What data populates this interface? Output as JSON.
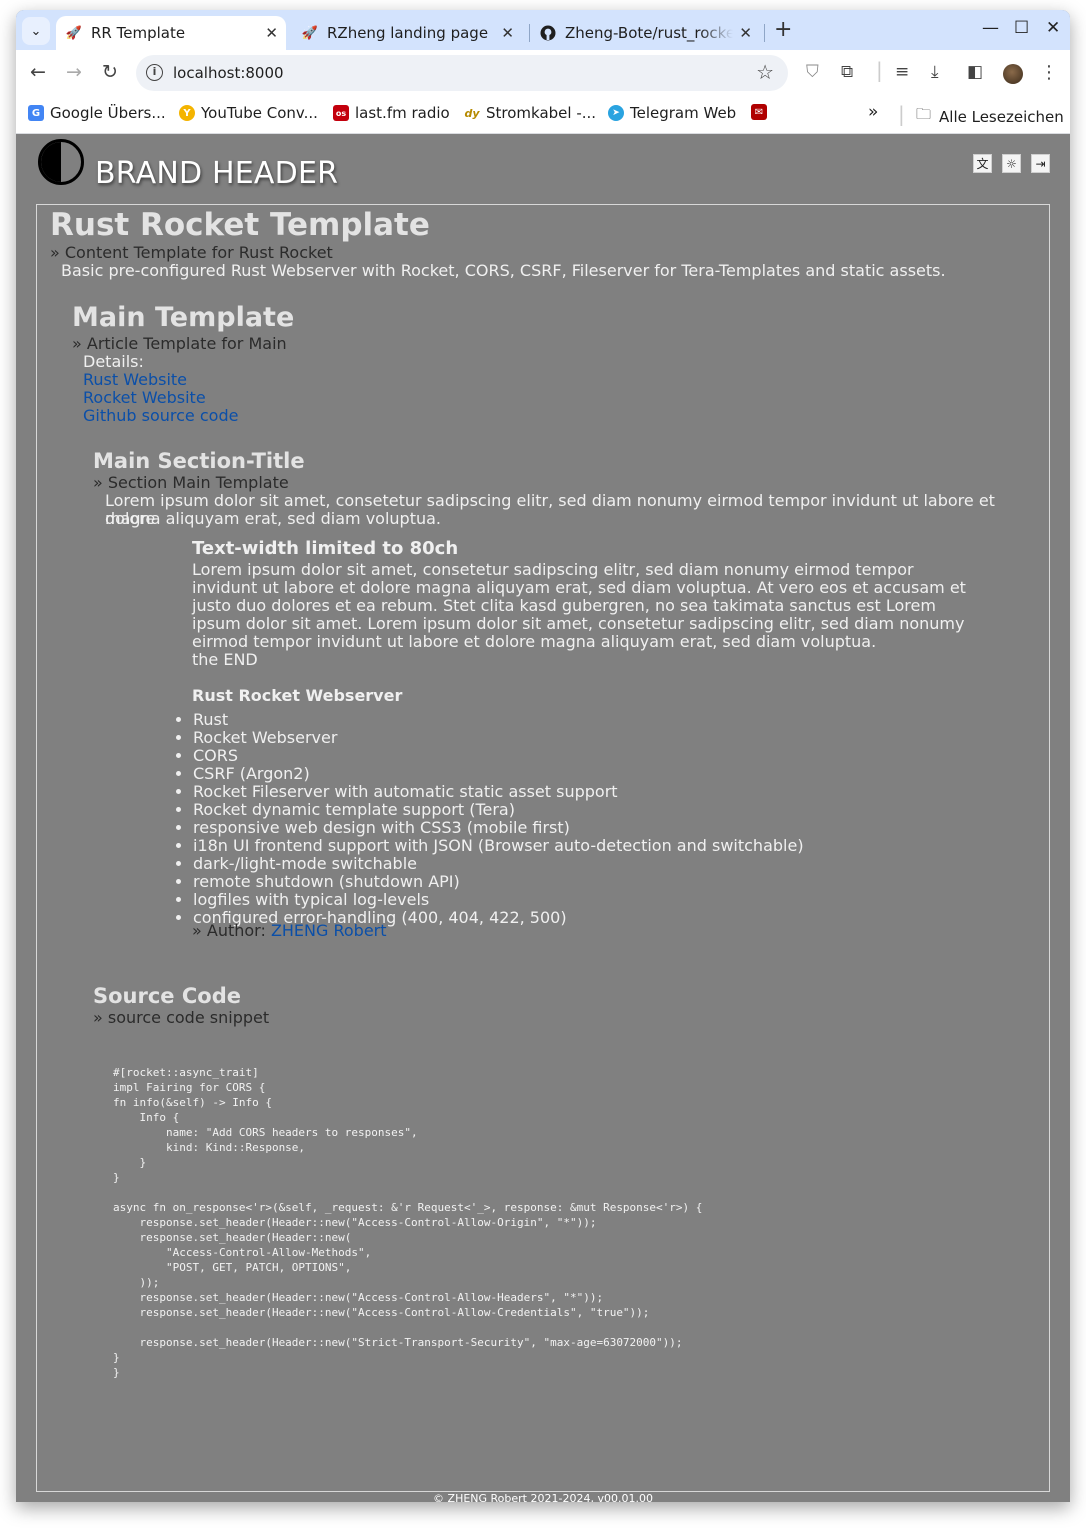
{
  "browser": {
    "tabs": [
      {
        "title": "RR Template",
        "close": "✕"
      },
      {
        "title": "RZheng landing page",
        "close": "✕"
      },
      {
        "title": "Zheng-Bote/rust_rocket",
        "close": "✕"
      }
    ],
    "new_tab": "+",
    "url": "localhost:8000",
    "window_controls": {
      "minimize": "—",
      "maximize": "☐",
      "close": "✕"
    },
    "bookmarks": [
      {
        "label": "Google Übers...",
        "icon": "G"
      },
      {
        "label": "YouTube Conv...",
        "icon": "Y"
      },
      {
        "label": "last.fm radio",
        "icon": "os"
      },
      {
        "label": "Stromkabel -...",
        "icon": "dy"
      },
      {
        "label": "Telegram Web",
        "icon": "➤"
      },
      {
        "label": "",
        "icon": "✉"
      }
    ],
    "bookmarks_overflow": "»",
    "all_bookmarks": "Alle Lesezeichen"
  },
  "header": {
    "brand": "BRAND HEADER",
    "icons": [
      "translate-icon",
      "sun-icon",
      "logout-icon"
    ]
  },
  "content": {
    "title": "Rust Rocket Template",
    "crumb": "» Content Template for Rust Rocket",
    "desc": "Basic pre-configured Rust Webserver with Rocket, CORS, CSRF, Fileserver for Tera-Templates and static assets.",
    "main": {
      "title": "Main Template",
      "crumb": "» Article Template for Main",
      "details_label": "Details:",
      "links": [
        "Rust Website",
        "Rocket Website",
        "Github source code"
      ]
    },
    "section": {
      "title": "Main Section-Title",
      "crumb": "» Section Main Template",
      "para_line1": "Lorem ipsum dolor sit amet, consetetur sadipscing elitr, sed diam nonumy eirmod tempor invidunt ut labore et dolore",
      "para_line2": "magna aliquyam erat, sed diam voluptua."
    },
    "textwidth": {
      "title": "Text-width limited to 80ch",
      "lines": [
        "Lorem ipsum dolor sit amet, consetetur sadipscing elitr, sed diam nonumy eirmod tempor",
        "invidunt ut labore et dolore magna aliquyam erat, sed diam voluptua. At vero eos et accusam et",
        "justo duo dolores et ea rebum. Stet clita kasd gubergren, no sea takimata sanctus est Lorem",
        "ipsum dolor sit amet. Lorem ipsum dolor sit amet, consetetur sadipscing elitr, sed diam nonumy",
        "eirmod tempor invidunt ut labore et dolore magna aliquyam erat, sed diam voluptua."
      ],
      "end": "the END"
    },
    "webserver": {
      "title": "Rust Rocket Webserver",
      "items": [
        "Rust",
        "Rocket Webserver",
        "CORS",
        "CSRF (Argon2)",
        "Rocket Fileserver with automatic static asset support",
        "Rocket dynamic template support (Tera)",
        "responsive web design with CSS3 (mobile first)",
        "i18n UI frontend support with JSON (Browser auto-detection and switchable)",
        "dark-/light-mode switchable",
        "remote shutdown (shutdown API)",
        "logfiles with typical log-levels",
        "configured error-handling (400, 404, 422, 500)"
      ],
      "author_prefix": "» Author: ",
      "author_name": "ZHENG Robert"
    },
    "source": {
      "title": "Source Code",
      "crumb": "» source code snippet",
      "code": "#[rocket::async_trait]\nimpl Fairing for CORS {\nfn info(&self) -> Info {\n    Info {\n        name: \"Add CORS headers to responses\",\n        kind: Kind::Response,\n    }\n}\n\nasync fn on_response<'r>(&self, _request: &'r Request<'_>, response: &mut Response<'r>) {\n    response.set_header(Header::new(\"Access-Control-Allow-Origin\", \"*\"));\n    response.set_header(Header::new(\n        \"Access-Control-Allow-Methods\",\n        \"POST, GET, PATCH, OPTIONS\",\n    ));\n    response.set_header(Header::new(\"Access-Control-Allow-Headers\", \"*\"));\n    response.set_header(Header::new(\"Access-Control-Allow-Credentials\", \"true\"));\n\n    response.set_header(Header::new(\"Strict-Transport-Security\", \"max-age=63072000\"));\n}\n}"
    }
  },
  "footer": "© ZHENG Robert 2021-2024, v00.01.00",
  "colors": {
    "page_bg": "#808080",
    "link": "#0b4fa8",
    "tabstrip": "#d3e3fd"
  }
}
